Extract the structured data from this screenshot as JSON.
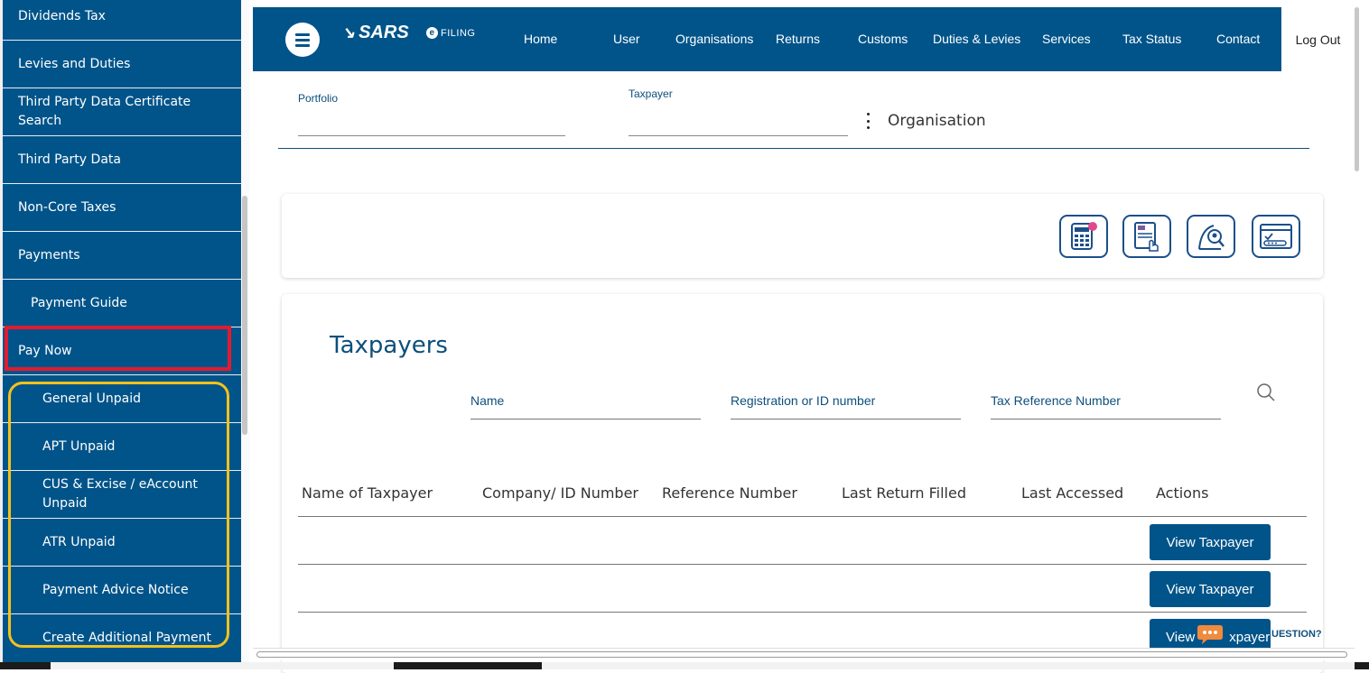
{
  "sidebar": {
    "items": [
      {
        "label": "Dividends Tax"
      },
      {
        "label": "Levies and Duties"
      },
      {
        "label": "Third Party Data Certificate Search"
      },
      {
        "label": "Third Party Data"
      },
      {
        "label": "Non-Core Taxes"
      },
      {
        "label": "Payments"
      },
      {
        "label": "Payment Guide"
      },
      {
        "label": "Pay Now"
      },
      {
        "label": "General Unpaid"
      },
      {
        "label": "APT Unpaid"
      },
      {
        "label": "CUS & Excise / eAccount Unpaid"
      },
      {
        "label": "ATR Unpaid"
      },
      {
        "label": "Payment Advice Notice"
      },
      {
        "label": "Create Additional Payment"
      }
    ]
  },
  "header": {
    "logo": "SARS",
    "filing": "FILING",
    "nav": [
      "Home",
      "User",
      "Organisations",
      "Returns",
      "Customs",
      "Duties & Levies",
      "Services",
      "Tax Status",
      "Contact"
    ],
    "logout": "Log Out"
  },
  "filters": {
    "portfolio_label": "Portfolio",
    "taxpayer_label": "Taxpayer",
    "selected_type": "Organisation"
  },
  "tools": {
    "icons": [
      "calculator-icon",
      "document-hand-icon",
      "search-person-icon",
      "id-card-icon"
    ]
  },
  "taxpayers": {
    "title": "Taxpayers",
    "search": {
      "name_label": "Name",
      "registration_label": "Registration or ID number",
      "tax_ref_label": "Tax Reference Number"
    },
    "columns": [
      "Name of Taxpayer",
      "Company/ ID Number",
      "Reference Number",
      "Last Return Filled",
      "Last Accessed",
      "Actions"
    ],
    "rows": [
      {
        "action": "View Taxpayer"
      },
      {
        "action": "View Taxpayer"
      },
      {
        "action": "View Taxpayer"
      }
    ],
    "row3_visible_text": "View",
    "row3_visible_text_end": "xpayer"
  },
  "chat": {
    "label": "UESTION?"
  },
  "colors": {
    "brand": "#01548a",
    "highlight_red": "#e21b2f",
    "highlight_yellow": "#f3c21b"
  }
}
